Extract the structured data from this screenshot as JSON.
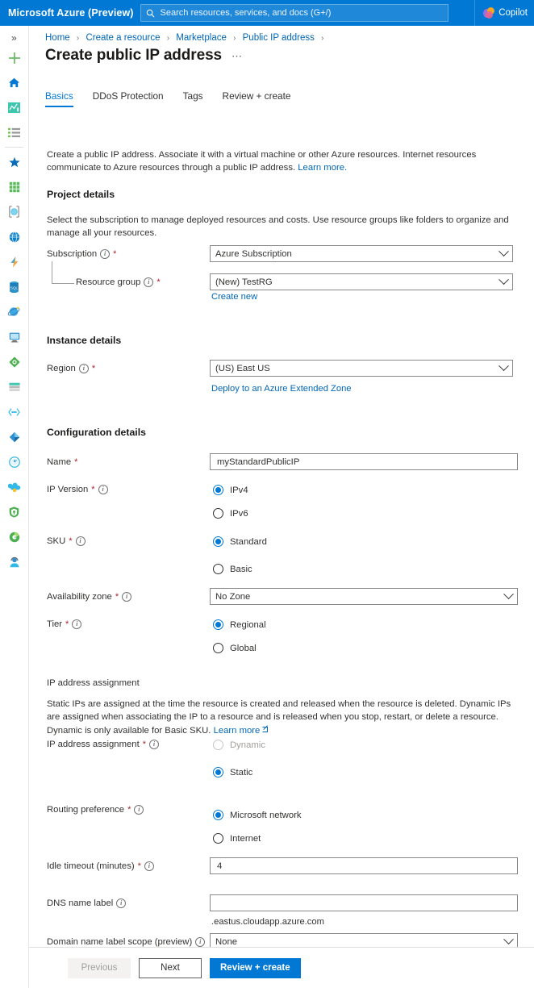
{
  "topbar": {
    "brand": "Microsoft Azure (Preview)",
    "search_placeholder": "Search resources, services, and docs (G+/)",
    "search_value": "",
    "copilot_label": "Copilot",
    "accent_color": "#0078d4"
  },
  "rail": {
    "toggle": "»",
    "items": [
      {
        "name": "create-resource-icon",
        "label": "Create a resource"
      },
      {
        "name": "home-icon",
        "label": "Home"
      },
      {
        "name": "dashboard-icon",
        "label": "Dashboard"
      },
      {
        "name": "all-services-icon",
        "label": "All services"
      },
      {
        "name": "favorites-icon",
        "label": "Favorites"
      },
      {
        "name": "all-resources-icon",
        "label": "All resources"
      },
      {
        "name": "resource-groups-icon",
        "label": "Resource groups"
      },
      {
        "name": "app-services-icon",
        "label": "App Services"
      },
      {
        "name": "function-app-icon",
        "label": "Function App"
      },
      {
        "name": "sql-databases-icon",
        "label": "SQL databases"
      },
      {
        "name": "cosmos-db-icon",
        "label": "Azure Cosmos DB"
      },
      {
        "name": "virtual-machines-icon",
        "label": "Virtual machines"
      },
      {
        "name": "load-balancers-icon",
        "label": "Load balancers"
      },
      {
        "name": "storage-accounts-icon",
        "label": "Storage accounts"
      },
      {
        "name": "virtual-networks-icon",
        "label": "Virtual networks"
      },
      {
        "name": "entra-id-icon",
        "label": "Microsoft Entra ID"
      },
      {
        "name": "monitor-icon",
        "label": "Monitor"
      },
      {
        "name": "advisor-icon",
        "label": "Advisor"
      },
      {
        "name": "defender-icon",
        "label": "Microsoft Defender for Cloud"
      },
      {
        "name": "cost-management-icon",
        "label": "Cost Management + Billing"
      },
      {
        "name": "help-support-icon",
        "label": "Help + support"
      }
    ]
  },
  "breadcrumb": {
    "items": [
      "Home",
      "Create a resource",
      "Marketplace",
      "Public IP address"
    ],
    "separator": "›"
  },
  "page": {
    "title": "Create public IP address",
    "more_actions": "⋯"
  },
  "tabs": [
    {
      "label": "Basics",
      "active": true
    },
    {
      "label": "DDoS Protection",
      "active": false
    },
    {
      "label": "Tags",
      "active": false
    },
    {
      "label": "Review + create",
      "active": false
    }
  ],
  "intro": {
    "text": "Create a public IP address. Associate it with a virtual machine or other Azure resources. Internet resources communicate to Azure resources through a public IP address. ",
    "link": "Learn more."
  },
  "project_details": {
    "heading": "Project details",
    "description": "Select the subscription to manage deployed resources and costs. Use resource groups like folders to organize and manage all your resources.",
    "subscription": {
      "label": "Subscription",
      "required": "*",
      "value": "Azure Subscription"
    },
    "resource_group": {
      "label": "Resource group",
      "required": "*",
      "value": "(New) TestRG",
      "create_new": "Create new"
    }
  },
  "instance_details": {
    "heading": "Instance details",
    "region": {
      "label": "Region",
      "required": "*",
      "value": "(US) East US"
    },
    "extended_zone_link": "Deploy to an Azure Extended Zone"
  },
  "configuration_details": {
    "heading": "Configuration details",
    "name": {
      "label": "Name",
      "required": "*",
      "value": "myStandardPublicIP"
    },
    "ip_version": {
      "label": "IP Version",
      "required": "*",
      "options": [
        {
          "label": "IPv4",
          "selected": true,
          "disabled": false
        },
        {
          "label": "IPv6",
          "selected": false,
          "disabled": false
        }
      ]
    },
    "sku": {
      "label": "SKU",
      "required": "*",
      "options": [
        {
          "label": "Standard",
          "selected": true,
          "disabled": false
        },
        {
          "label": "Basic",
          "selected": false,
          "disabled": false
        }
      ]
    },
    "availability_zone": {
      "label": "Availability zone",
      "required": "*",
      "value": "No Zone"
    },
    "tier": {
      "label": "Tier",
      "required": "*",
      "options": [
        {
          "label": "Regional",
          "selected": true,
          "disabled": false
        },
        {
          "label": "Global",
          "selected": false,
          "disabled": false
        }
      ]
    },
    "ip_assignment_heading": "IP address assignment",
    "ip_assignment_description": "Static IPs are assigned at the time the resource is created and released when the resource is deleted. Dynamic IPs are assigned when associating the IP to a resource and is released when you stop, restart, or delete a resource. Dynamic is only available for Basic SKU. ",
    "ip_assignment_link": "Learn more",
    "ip_assignment": {
      "label": "IP address assignment",
      "required": "*",
      "options": [
        {
          "label": "Dynamic",
          "selected": false,
          "disabled": true
        },
        {
          "label": "Static",
          "selected": true,
          "disabled": false
        }
      ]
    },
    "routing_preference": {
      "label": "Routing preference",
      "required": "*",
      "options": [
        {
          "label": "Microsoft network",
          "selected": true,
          "disabled": false
        },
        {
          "label": "Internet",
          "selected": false,
          "disabled": false
        }
      ]
    },
    "idle_timeout": {
      "label": "Idle timeout (minutes)",
      "required": "*",
      "value": "4"
    },
    "dns_name_label": {
      "label": "DNS name label",
      "value": "",
      "suffix": ".eastus.cloudapp.azure.com"
    },
    "domain_scope": {
      "label": "Domain name label scope (preview)",
      "value": "None"
    }
  },
  "footer": {
    "previous": "Previous",
    "next": "Next",
    "review_create": "Review + create"
  }
}
